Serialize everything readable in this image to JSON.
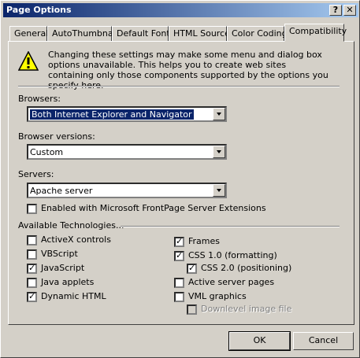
{
  "window": {
    "title": "Page Options"
  },
  "titlebar_buttons": {
    "help": "?",
    "close": "✕"
  },
  "tabs": [
    {
      "label": "General"
    },
    {
      "label": "AutoThumbnail"
    },
    {
      "label": "Default Font"
    },
    {
      "label": "HTML Source"
    },
    {
      "label": "Color Coding"
    },
    {
      "label": "Compatibility",
      "active": true
    }
  ],
  "warning": {
    "icon": "warning-icon",
    "text": "Changing these settings may make some menu and dialog box options unavailable. This helps you to create web sites containing only those components supported by the options you specify here."
  },
  "browsers": {
    "label": "Browsers:",
    "value": "Both Internet Explorer and Navigator"
  },
  "browser_versions": {
    "label": "Browser versions:",
    "value": "Custom"
  },
  "servers": {
    "label": "Servers:",
    "value": "Apache server"
  },
  "frontpage_extensions": {
    "label": "Enabled with Microsoft FrontPage Server Extensions",
    "checked": false
  },
  "technologies": {
    "label": "Available Technologies...",
    "left": [
      {
        "label": "ActiveX controls",
        "checked": false
      },
      {
        "label": "VBScript",
        "checked": false
      },
      {
        "label": "JavaScript",
        "checked": true
      },
      {
        "label": "Java applets",
        "checked": false
      },
      {
        "label": "Dynamic HTML",
        "checked": true
      }
    ],
    "right": [
      {
        "label": "Frames",
        "checked": true
      },
      {
        "label": "CSS 1.0  (formatting)",
        "checked": true
      },
      {
        "label": "CSS 2.0  (positioning)",
        "checked": true
      },
      {
        "label": "Active server pages",
        "checked": false
      },
      {
        "label": "VML graphics",
        "checked": false
      },
      {
        "label": "Downlevel image file",
        "checked": false,
        "disabled": true
      }
    ]
  },
  "buttons": {
    "ok": "OK",
    "cancel": "Cancel"
  }
}
